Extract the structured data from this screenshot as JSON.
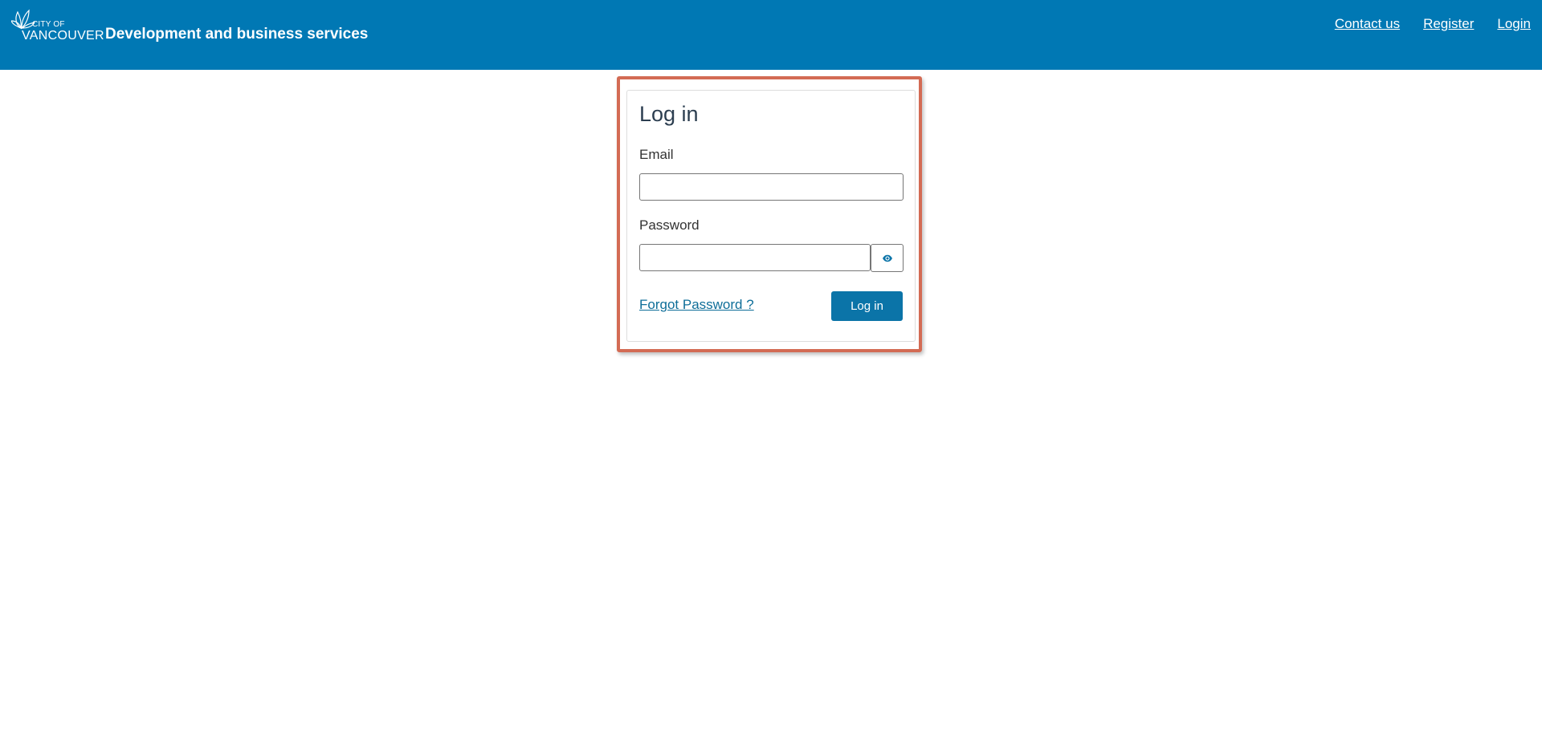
{
  "header": {
    "logo": {
      "line1": "CITY OF",
      "line2": "VANCOUVER",
      "icon": "lotus-leaf-icon"
    },
    "site_title": "Development and business services",
    "nav": [
      {
        "label": "Contact us"
      },
      {
        "label": "Register"
      },
      {
        "label": "Login"
      }
    ],
    "background_color": "#0078b4"
  },
  "login_form": {
    "title": "Log in",
    "email_label": "Email",
    "email_value": "",
    "password_label": "Password",
    "password_value": "",
    "show_password_icon": "eye-icon",
    "forgot_password_label": "Forgot Password ?",
    "submit_label": "Log in",
    "highlight_color": "#d36b54",
    "button_color": "#0b74a8"
  }
}
